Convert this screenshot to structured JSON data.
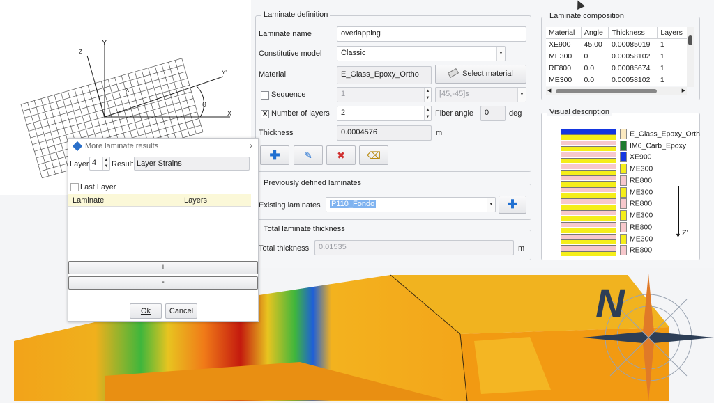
{
  "laminate_definition": {
    "title": "Laminate definition",
    "name_label": "Laminate name",
    "name_value": "overlapping",
    "model_label": "Constitutive model",
    "model_value": "Classic",
    "material_label": "Material",
    "material_value": "E_Glass_Epoxy_Ortho",
    "select_material_label": "Select material",
    "sequence_label": "Sequence",
    "sequence_value": "1",
    "sequence_pattern": "[45,-45]s",
    "num_layers_label": "Number of layers",
    "num_layers_value": "2",
    "num_layers_checked": "X",
    "fiber_angle_label": "Fiber angle",
    "fiber_angle_value": "0",
    "fiber_angle_unit": "deg",
    "thickness_label": "Thickness",
    "thickness_value": "0.0004576",
    "thickness_unit": "m"
  },
  "previous": {
    "title": "Previously defined laminates",
    "existing_label": "Existing laminates",
    "existing_value": "P110_Fondo"
  },
  "total": {
    "title": "Total laminate thickness",
    "label": "Total thickness",
    "value": "0.01535",
    "unit": "m"
  },
  "composition": {
    "title": "Laminate composition",
    "headers": [
      "Material",
      "Angle",
      "Thickness",
      "Layers"
    ],
    "rows": [
      [
        "XE900",
        "45.00",
        "0.00085019",
        "1"
      ],
      [
        "ME300",
        "0",
        "0.00058102",
        "1"
      ],
      [
        "RE800",
        "0.0",
        "0.00085674",
        "1"
      ],
      [
        "ME300",
        "0.0",
        "0.00058102",
        "1"
      ]
    ]
  },
  "visual": {
    "title": "Visual description",
    "legend": [
      {
        "label": "E_Glass_Epoxy_Orth",
        "color": "#fbe9c0"
      },
      {
        "label": "IM6_Carb_Epoxy",
        "color": "#1e7a2e"
      },
      {
        "label": "XE900",
        "color": "#1436e0"
      },
      {
        "label": "ME300",
        "color": "#f5ee1a"
      },
      {
        "label": "RE800",
        "color": "#f7c8cc"
      },
      {
        "label": "ME300",
        "color": "#f5ee1a"
      },
      {
        "label": "RE800",
        "color": "#f7c8cc"
      },
      {
        "label": "ME300",
        "color": "#f5ee1a"
      },
      {
        "label": "RE800",
        "color": "#f7c8cc"
      },
      {
        "label": "ME300",
        "color": "#f5ee1a"
      },
      {
        "label": "RE800",
        "color": "#f7c8cc"
      }
    ],
    "axis_label": "Z'"
  },
  "dialog": {
    "title": "More laminate results",
    "layer_label": "Layer:",
    "layer_value": "4",
    "result_label": "Result:",
    "result_value": "Layer Strains",
    "last_layer_label": "Last Layer",
    "col_laminate": "Laminate",
    "col_layers": "Layers",
    "plus": "+",
    "minus": "-",
    "ok": "Ok",
    "cancel": "Cancel"
  },
  "diagram": {
    "axes": [
      "Y",
      "Z",
      "Y'",
      "X",
      "X'",
      "θ"
    ]
  },
  "compass": {
    "letter": "N"
  }
}
